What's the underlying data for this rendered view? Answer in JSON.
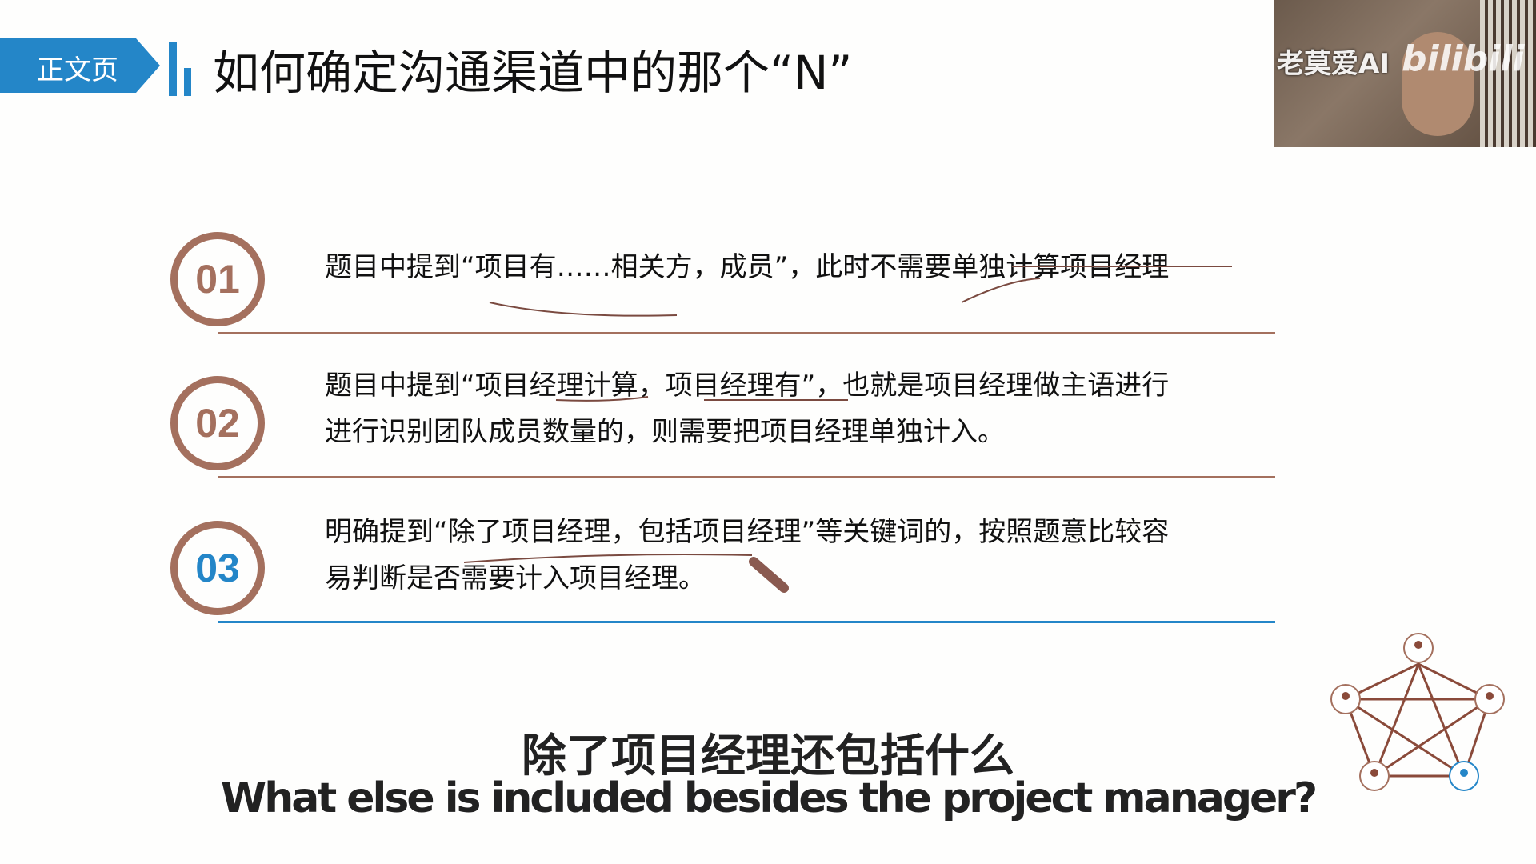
{
  "header": {
    "section_label": "正文页",
    "title": "如何确定沟通渠道中的那个“N”"
  },
  "webcam": {
    "watermark": "老莫爱AI",
    "logo": "bilibili"
  },
  "items": [
    {
      "number": "01",
      "lines": [
        "题目中提到“项目有……相关方，成员”，此时不需要单独计算项目经理"
      ]
    },
    {
      "number": "02",
      "lines": [
        "题目中提到“项目经理计算，项目经理有”，也就是项目经理做主语进行",
        "进行识别团队成员数量的，则需要把项目经理单独计入。"
      ]
    },
    {
      "number": "03",
      "lines": [
        "明确提到“除了项目经理，包括项目经理”等关键词的，按照题意比较容",
        "易判断是否需要计入项目经理。"
      ]
    }
  ],
  "subtitles": {
    "zh": "除了项目经理还包括什么",
    "en": "What else is included besides the project manager?"
  },
  "colors": {
    "accent_blue": "#2486c8",
    "accent_brown": "#a4705e"
  },
  "icons": {
    "network": "communication-network-pentagon-icon",
    "pen": "pen-cursor-icon"
  }
}
